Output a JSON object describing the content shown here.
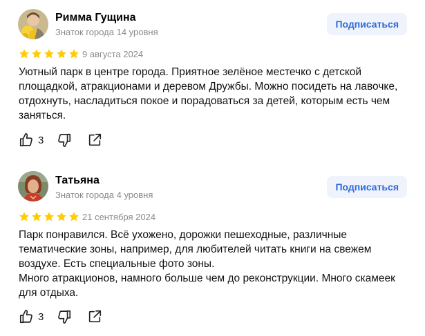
{
  "reviews": [
    {
      "author": "Римма Гущина",
      "level": "Знаток города 14 уровня",
      "subscribe_label": "Подписаться",
      "rating": 5,
      "date": "9 августа 2024",
      "text_lines": [
        "Уютный парк в центре города. Приятное зелёное местечко с детской площадкой, атракционами и деревом Дружбы. Можно посидеть на лавочке, отдохнуть, насладиться покое и порадоваться за детей, которым есть чем заняться."
      ],
      "likes": "3",
      "icons": [
        "thumbs-up-icon",
        "thumbs-down-icon",
        "share-icon"
      ]
    },
    {
      "author": "Татьяна",
      "level": "Знаток города 4 уровня",
      "subscribe_label": "Подписаться",
      "rating": 5,
      "date": "21 сентября 2024",
      "text_lines": [
        "Парк понравился. Всё ухожено, дорожки пешеходные, различные тематические зоны, например, для любителей читать книги на свежем воздухе. Есть специальные фото зоны.",
        "Много атракционов, намного больше чем до реконструкции. Много скамеек для отдыха."
      ],
      "likes": "3",
      "icons": [
        "thumbs-up-icon",
        "thumbs-down-icon",
        "share-icon"
      ]
    }
  ],
  "colors": {
    "star": "#fc0",
    "subscribe_bg": "#eef3fc",
    "subscribe_text": "#2f6ad8",
    "muted_text": "#8a8a8a"
  }
}
